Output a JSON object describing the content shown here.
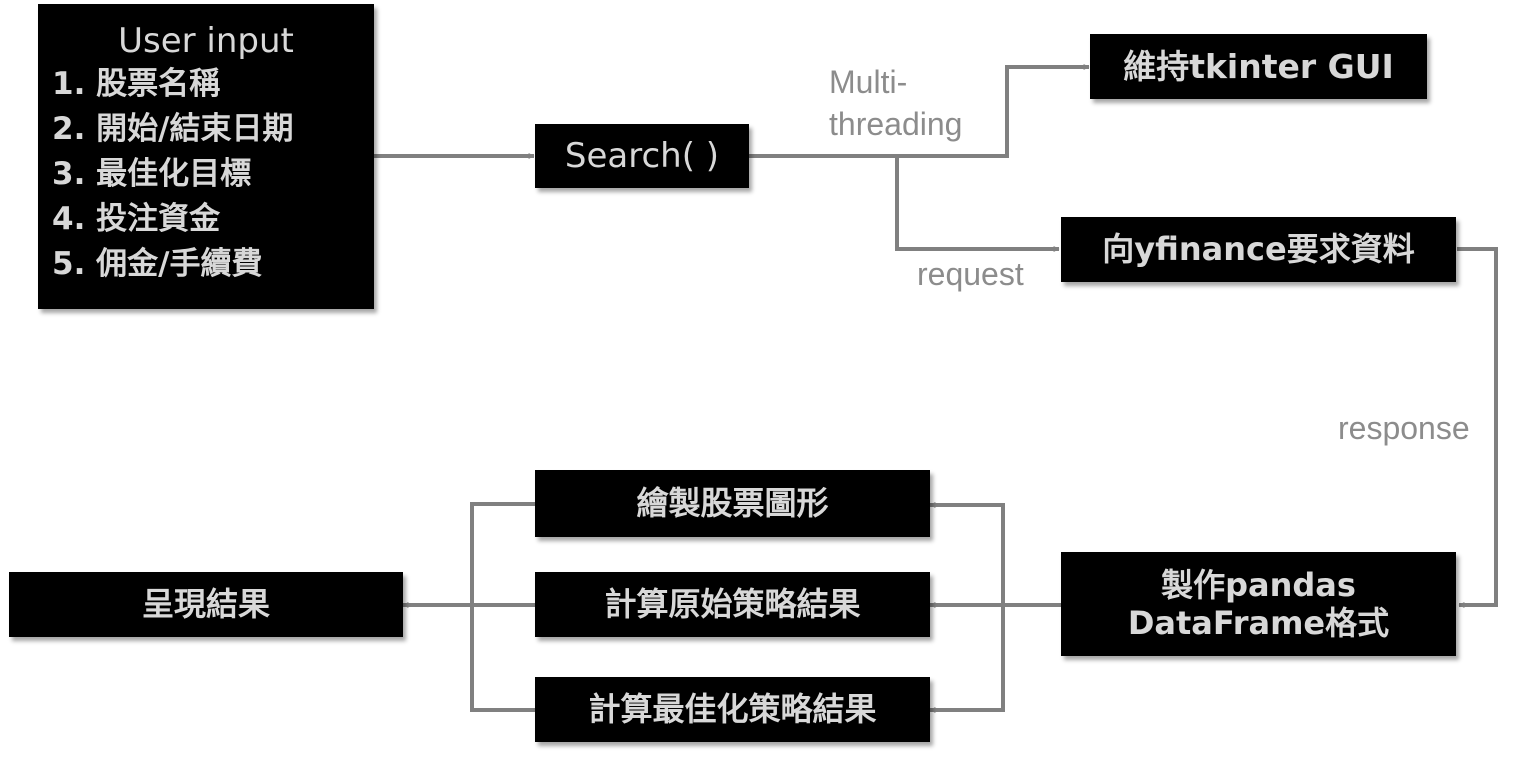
{
  "nodes": {
    "user_input": {
      "title": "User input",
      "items": [
        "1. 股票名稱",
        "2. 開始/結束日期",
        "3. 最佳化目標",
        "4. 投注資金",
        "5. 佣金/手續費"
      ]
    },
    "search": "Search( )",
    "gui": "維持tkinter GUI",
    "yfinance": "向yfinance要求資料",
    "dataframe": {
      "line1": "製作pandas",
      "line2": "DataFrame格式"
    },
    "plot": "繪製股票圖形",
    "original": "計算原始策略結果",
    "optimized": "計算最佳化策略結果",
    "result": "呈現結果"
  },
  "edge_labels": {
    "multithreading_line1": "Multi-",
    "multithreading_line2": "threading",
    "request": "request",
    "response": "response"
  },
  "colors": {
    "box_fill": "#000000",
    "box_text": "#d8d8d8",
    "connector": "#808080",
    "label": "#8c8c8c"
  }
}
